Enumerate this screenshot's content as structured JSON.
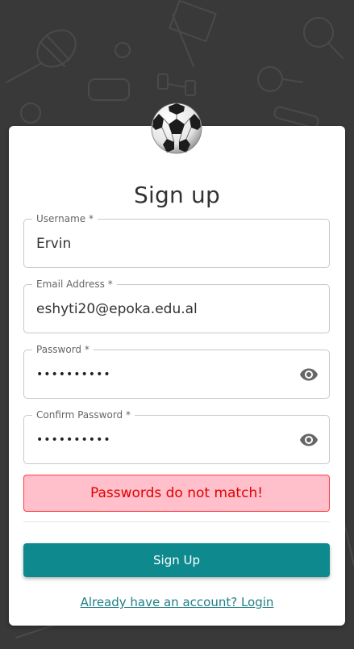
{
  "form": {
    "title": "Sign up",
    "username": {
      "label": "Username *",
      "value": "Ervin"
    },
    "email": {
      "label": "Email Address *",
      "value": "eshyti20@epoka.edu.al"
    },
    "password": {
      "label": "Password *",
      "value": "••••••••••"
    },
    "confirm_password": {
      "label": "Confirm Password *",
      "value": "••••••••••"
    },
    "error_message": "Passwords do not match!",
    "submit_label": "Sign Up",
    "login_link": "Already have an account? Login"
  },
  "icons": {
    "logo": "soccer-ball-icon",
    "password_toggle": "eye-icon",
    "confirm_password_toggle": "eye-icon"
  },
  "colors": {
    "background": "#3a3939",
    "card": "#ffffff",
    "primary_button": "#0e8a8f",
    "link": "#1f7f86",
    "error_bg": "#ffc0cb",
    "error_border": "#ff3b3b",
    "error_text": "#e00000"
  }
}
